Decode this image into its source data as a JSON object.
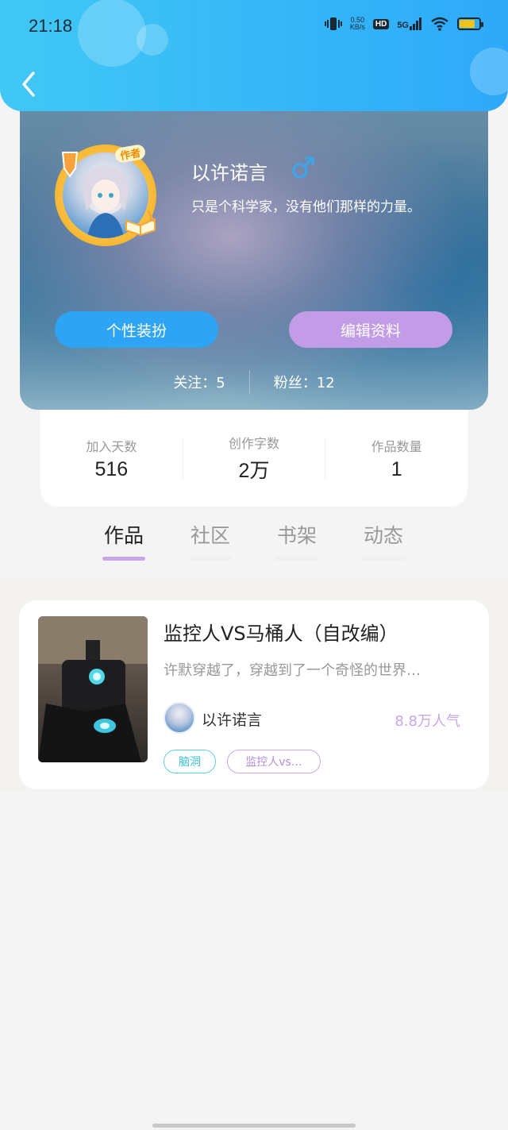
{
  "status_bar": {
    "time": "21:18",
    "net_speed_value": "0.50",
    "net_speed_unit": "KB/s",
    "hd_label": "HD",
    "network_label": "5G",
    "battery_level": 0.8,
    "battery_color": "#f5c21b"
  },
  "header": {
    "back_icon": "chevron-left-icon",
    "accent": "#2ea9f9"
  },
  "profile": {
    "badge": "作者",
    "username": "以许诺言",
    "gender_icon": "male-icon",
    "bio": "只是个科学家，没有他们那样的力量。",
    "dress_button": "个性装扮",
    "edit_button": "编辑资料",
    "following_label": "关注：5",
    "followers_label": "粉丝：12"
  },
  "stats": [
    {
      "label": "加入天数",
      "value": "516"
    },
    {
      "label": "创作字数",
      "value": "2万"
    },
    {
      "label": "作品数量",
      "value": "1"
    }
  ],
  "tabs": [
    {
      "label": "作品",
      "active": true
    },
    {
      "label": "社区",
      "active": false
    },
    {
      "label": "书架",
      "active": false
    },
    {
      "label": "动态",
      "active": false
    }
  ],
  "works": [
    {
      "title": "监控人VS马桶人（自改编）",
      "description": "许默穿越了，穿越到了一个奇怪的世界…",
      "author": "以许诺言",
      "popularity": "8.8万人气",
      "tags": [
        "脑洞",
        "监控人vs…"
      ]
    }
  ],
  "colors": {
    "dress_button": "#2ea4f4",
    "edit_button": "#c39ce8",
    "active_tab_underline": "#c8a6ea",
    "popularity": "#c8a6ea"
  }
}
